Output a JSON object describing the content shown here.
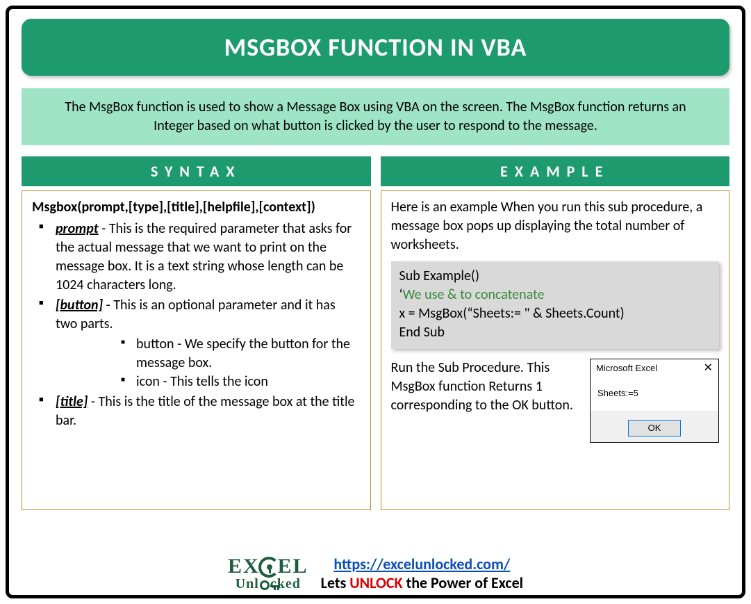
{
  "title": "MSGBOX FUNCTION IN VBA",
  "description": "The MsgBox function is used to show a Message Box using VBA on the screen. The MsgBox function returns an Integer based on what button is clicked by the user to respond to the message.",
  "syntax": {
    "heading": "SYNTAX",
    "signature": "Msgbox(prompt,[type],[title],[helpfile],[context])",
    "params": [
      {
        "name": "prompt",
        "sep": " - ",
        "text": "This is the required parameter that asks for the actual message that we want to print on the message box. It is a text string whose length can be 1024 characters long."
      },
      {
        "name": "[button]",
        "sep": " - ",
        "text": "This is an optional parameter and it has two parts.",
        "sub": [
          "button - We specify the button for the message box.",
          "icon - This tells the icon"
        ]
      },
      {
        "name": "[title]",
        "sep": " - ",
        "text": "This is the title of the message box at the title bar."
      }
    ]
  },
  "example": {
    "heading": "EXAMPLE",
    "intro": "Here is an example When you run this sub procedure, a message box pops up displaying the total number of worksheets.",
    "code": {
      "l1": "Sub Example()",
      "comment_tick": "‘",
      "comment_text": "We use & to concatenate",
      "l3": "x = MsgBox(“Sheets:= \" & Sheets.Count)",
      "l4": "End Sub"
    },
    "run_text": "Run the Sub Procedure. This MsgBox function Returns 1 corresponding to the OK button.",
    "dialog": {
      "title": "Microsoft Excel",
      "close": "✕",
      "body": "Sheets:=5",
      "ok": "OK"
    }
  },
  "footer": {
    "logo_top_left": "EX",
    "logo_top_right": "EL",
    "logo_bottom_left": "Unl",
    "logo_bottom_right": "cked",
    "url_text": "https://excelunlocked.com/",
    "url_href": "https://excelunlocked.com/",
    "tag_pre": "Lets ",
    "tag_mid": "UNLOCK",
    "tag_post": " the Power of Excel"
  }
}
